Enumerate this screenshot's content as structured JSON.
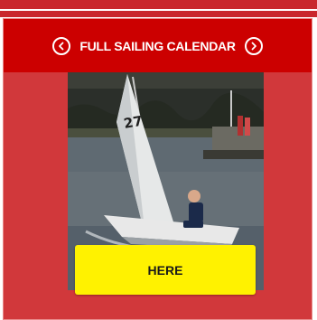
{
  "header": {
    "title": "FULL SAILING CALENDAR",
    "prev_icon": "chevron-left-circle-icon",
    "next_icon": "chevron-right-circle-icon"
  },
  "photo": {
    "sail_number": "27",
    "alt_description_icon": "dinghy-photo"
  },
  "cta": {
    "label": "HERE"
  },
  "colors": {
    "header_red": "#cc0000",
    "panel_red": "#d1383b",
    "button_yellow": "#fff200"
  }
}
